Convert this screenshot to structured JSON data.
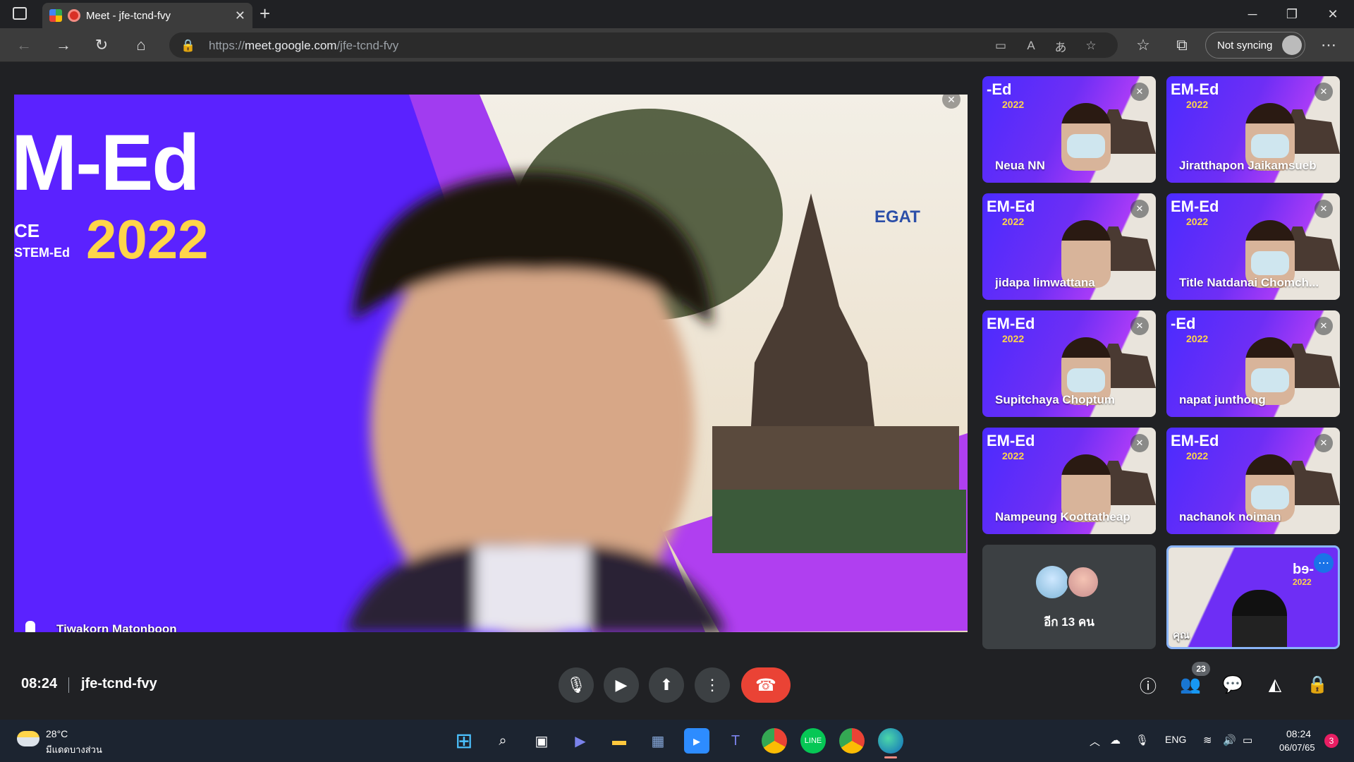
{
  "browser": {
    "tab_title": "Meet - jfe-tcnd-fvy",
    "url_prefix": "https://",
    "url_domain": "meet.google.com",
    "url_path": "/jfe-tcnd-fvy",
    "sync_label": "Not syncing"
  },
  "main_video": {
    "speaker_name": "Tiwakorn Matonboon",
    "backdrop_title": "M-Ed",
    "backdrop_year": "2022",
    "backdrop_sub1": "CE",
    "backdrop_sub2": "STEM-Ed",
    "backdrop_sponsor": "EGAT"
  },
  "participants": [
    {
      "name": "Neua NN",
      "stem": "-Ed",
      "year": "2022",
      "mask": true
    },
    {
      "name": "Jiratthapon Jaikamsueb",
      "stem": "EM-Ed",
      "year": "2022",
      "mask": true
    },
    {
      "name": "jidapa limwattana",
      "stem": "EM-Ed",
      "year": "2022",
      "mask": false
    },
    {
      "name": "Title Natdanai Chomch...",
      "stem": "EM-Ed",
      "year": "2022",
      "mask": true
    },
    {
      "name": "Supitchaya Choptum",
      "stem": "EM-Ed",
      "year": "2022",
      "mask": true
    },
    {
      "name": "napat junthong",
      "stem": "-Ed",
      "year": "2022",
      "mask": true
    },
    {
      "name": "Nampeung Koottatheap",
      "stem": "EM-Ed",
      "year": "2022",
      "mask": false
    },
    {
      "name": "nachanok noiman",
      "stem": "EM-Ed",
      "year": "2022",
      "mask": true
    }
  ],
  "more_tile": {
    "label": "อีก 13 คน"
  },
  "self_tile": {
    "label": "คุณ",
    "stem": "bɘ-",
    "year": "2022"
  },
  "meeting": {
    "time": "08:24",
    "code": "jfe-tcnd-fvy",
    "participant_count": "23"
  },
  "taskbar": {
    "weather_temp": "28°C",
    "weather_desc": "มีแดดบางส่วน",
    "lang": "ENG",
    "clock_time": "08:24",
    "clock_date": "06/07/65",
    "notif_count": "3"
  },
  "colors": {
    "accent_blue": "#8ab4f8",
    "end_call_red": "#ea4335",
    "stem_purple": "#6e2ef5",
    "year_yellow": "#ffd54a"
  }
}
